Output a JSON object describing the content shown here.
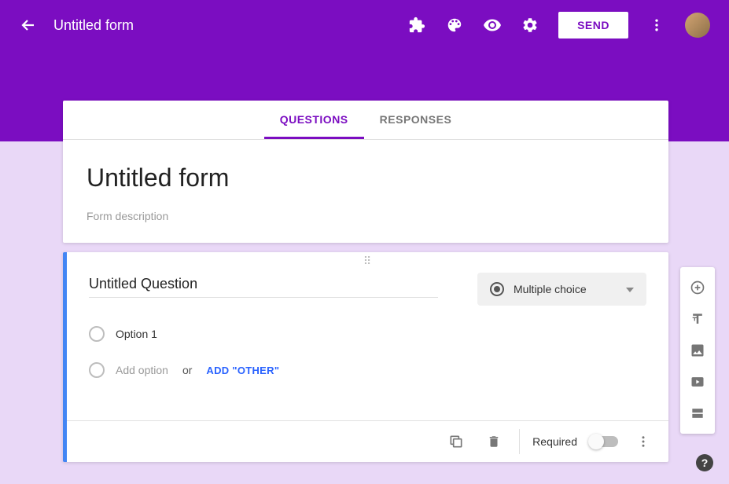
{
  "header": {
    "title": "Untitled form",
    "send_label": "SEND"
  },
  "tabs": {
    "questions": "QUESTIONS",
    "responses": "RESPONSES"
  },
  "form": {
    "title": "Untitled form",
    "description_placeholder": "Form description"
  },
  "question": {
    "title": "Untitled Question",
    "type_label": "Multiple choice",
    "options": [
      {
        "label": "Option 1"
      }
    ],
    "add_option": "Add option",
    "or_text": "or",
    "add_other": "ADD \"OTHER\"",
    "required_label": "Required"
  },
  "help": "?"
}
